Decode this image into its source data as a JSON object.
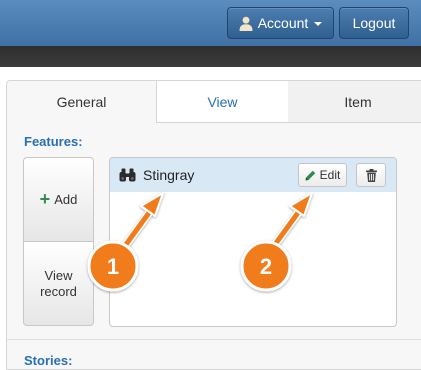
{
  "header": {
    "account_label": "Account",
    "logout_label": "Logout"
  },
  "tabs": [
    {
      "label": "General",
      "active": true
    },
    {
      "label": "View",
      "active": false
    },
    {
      "label": "Item",
      "active": false
    }
  ],
  "features": {
    "label": "Features:",
    "add_label": "Add",
    "view_record_line1": "View",
    "view_record_line2": "record",
    "items": [
      {
        "name": "Stingray",
        "icon": "binoculars-icon",
        "edit_label": "Edit"
      }
    ]
  },
  "stories": {
    "label": "Stories:"
  },
  "annotations": [
    {
      "number": "1",
      "color": "#f07b1a"
    },
    {
      "number": "2",
      "color": "#f07b1a"
    }
  ],
  "colors": {
    "header_blue": "#4a7db3",
    "accent_blue": "#2a6fb5",
    "selected_row": "#d9e8f5",
    "add_green": "#2f8a4e",
    "marker_orange": "#f07b1a"
  }
}
